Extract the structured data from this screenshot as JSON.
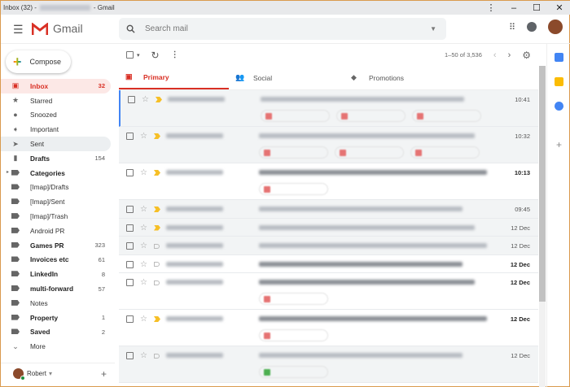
{
  "window": {
    "title_prefix": "Inbox (32) -",
    "title_suffix": "- Gmail",
    "menu": "⋮",
    "minimize": "–",
    "maximize": "☐",
    "close": "✕"
  },
  "header": {
    "app_name": "Gmail",
    "search_placeholder": "Search mail"
  },
  "compose_label": "Compose",
  "nav": [
    {
      "label": "Inbox",
      "count": "32",
      "icon": "inbox-icon"
    },
    {
      "label": "Starred",
      "count": "",
      "icon": "star-icon"
    },
    {
      "label": "Snoozed",
      "count": "",
      "icon": "clock-icon"
    },
    {
      "label": "Important",
      "count": "",
      "icon": "important-icon"
    },
    {
      "label": "Sent",
      "count": "",
      "icon": "send-icon"
    },
    {
      "label": "Drafts",
      "count": "154",
      "icon": "draft-icon"
    },
    {
      "label": "Categories",
      "count": "",
      "icon": "label-icon"
    },
    {
      "label": "[Imap]/Drafts",
      "count": "",
      "icon": "label-icon"
    },
    {
      "label": "[Imap]/Sent",
      "count": "",
      "icon": "label-icon"
    },
    {
      "label": "[Imap]/Trash",
      "count": "",
      "icon": "label-icon"
    },
    {
      "label": "Android PR",
      "count": "",
      "icon": "label-icon"
    },
    {
      "label": "Games PR",
      "count": "323",
      "icon": "label-icon"
    },
    {
      "label": "Invoices etc",
      "count": "61",
      "icon": "label-icon"
    },
    {
      "label": "LinkedIn",
      "count": "8",
      "icon": "label-icon"
    },
    {
      "label": "multi-forward",
      "count": "57",
      "icon": "label-icon"
    },
    {
      "label": "Notes",
      "count": "",
      "icon": "label-icon"
    },
    {
      "label": "Property",
      "count": "1",
      "icon": "label-icon"
    },
    {
      "label": "Saved",
      "count": "2",
      "icon": "label-icon"
    },
    {
      "label": "More",
      "count": "",
      "icon": "chevron-down-icon"
    }
  ],
  "user": {
    "name": "Robert"
  },
  "toolbar": {
    "pagination": "1–50 of 3,536"
  },
  "tabs": [
    {
      "label": "Primary"
    },
    {
      "label": "Social"
    },
    {
      "label": "Promotions"
    }
  ],
  "emails": [
    {
      "time": "10:41",
      "read": true,
      "important": true,
      "chips": 3,
      "focus": true
    },
    {
      "time": "10:32",
      "read": true,
      "important": true,
      "chips": 3
    },
    {
      "time": "10:13",
      "read": false,
      "important": true,
      "chips": 1
    },
    {
      "time": "09:45",
      "read": true,
      "important": true,
      "chips": 0
    },
    {
      "time": "12 Dec",
      "read": true,
      "important": true,
      "chips": 0
    },
    {
      "time": "12 Dec",
      "read": true,
      "important": false,
      "chips": 0
    },
    {
      "time": "12 Dec",
      "read": false,
      "important": false,
      "chips": 0
    },
    {
      "time": "12 Dec",
      "read": false,
      "important": false,
      "chips": 1
    },
    {
      "time": "12 Dec",
      "read": false,
      "important": true,
      "chips": 1
    },
    {
      "time": "12 Dec",
      "read": true,
      "important": false,
      "chips": 1,
      "green": true
    }
  ],
  "colors": {
    "accent": "#d93025",
    "active_bg": "#fce8e6",
    "important": "#f6bf26"
  }
}
